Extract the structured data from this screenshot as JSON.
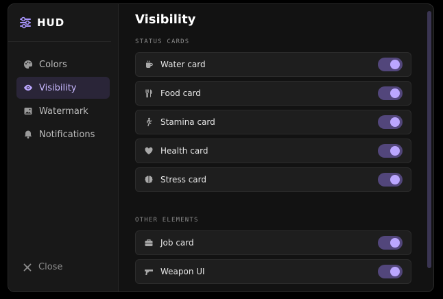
{
  "app": {
    "name": "HUD"
  },
  "nav": {
    "items": [
      {
        "label": "Colors",
        "icon": "palette-icon",
        "active": false
      },
      {
        "label": "Visibility",
        "icon": "eye-icon",
        "active": true
      },
      {
        "label": "Watermark",
        "icon": "image-icon",
        "active": false
      },
      {
        "label": "Notifications",
        "icon": "bell-icon",
        "active": false
      }
    ],
    "close_label": "Close"
  },
  "page": {
    "title": "Visibility",
    "sections": [
      {
        "label": "STATUS CARDS",
        "items": [
          {
            "label": "Water card",
            "icon": "water-drop-icon",
            "enabled": true
          },
          {
            "label": "Food card",
            "icon": "utensils-icon",
            "enabled": true
          },
          {
            "label": "Stamina card",
            "icon": "running-person-icon",
            "enabled": true
          },
          {
            "label": "Health card",
            "icon": "heart-icon",
            "enabled": true
          },
          {
            "label": "Stress card",
            "icon": "brain-icon",
            "enabled": true
          }
        ]
      },
      {
        "label": "OTHER ELEMENTS",
        "items": [
          {
            "label": "Job card",
            "icon": "briefcase-icon",
            "enabled": true
          },
          {
            "label": "Weapon UI",
            "icon": "gun-icon",
            "enabled": true
          }
        ]
      }
    ]
  },
  "colors": {
    "accent": "#bba6ff",
    "toggle_track": "#52467b",
    "active_nav_bg": "#2a2538"
  }
}
